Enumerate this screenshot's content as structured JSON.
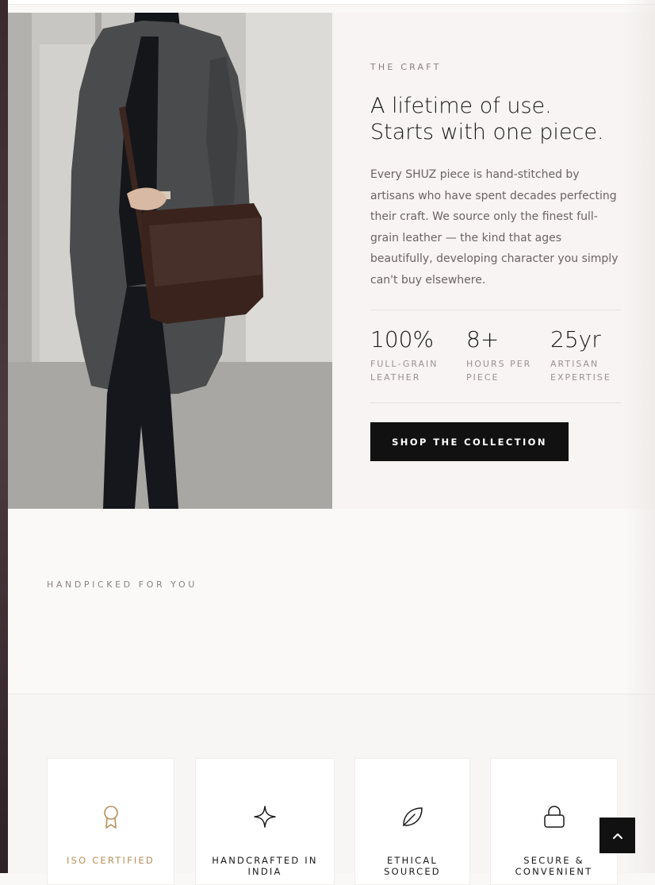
{
  "craft": {
    "eyebrow": "THE CRAFT",
    "title_lines": [
      "A lifetime of use.",
      "Starts with one piece."
    ],
    "body": "Every SHUZ piece is hand-stitched by artisans who have spent decades perfecting their craft. We source only the finest full-grain leather — the kind that ages beautifully, developing character you simply can't buy elsewhere.",
    "stats": [
      {
        "value": "100%",
        "label": "FULL-GRAIN LEATHER"
      },
      {
        "value": "8+",
        "label": "HOURS PER PIECE"
      },
      {
        "value": "25yr",
        "label": "ARTISAN EXPERTISE"
      }
    ],
    "cta_label": "SHOP THE COLLECTION",
    "image_icon": "man-with-leather-messenger-bag-photo"
  },
  "handpicked": {
    "eyebrow": "HANDPICKED FOR YOU"
  },
  "features": [
    {
      "icon": "award-ribbon-icon",
      "label": "ISO CERTIFIED",
      "color": "#b8905a"
    },
    {
      "icon": "sparkle-icon",
      "label": "HANDCRAFTED IN INDIA"
    },
    {
      "icon": "leaf-icon",
      "label": "ETHICAL SOURCED"
    },
    {
      "icon": "lock-icon",
      "label": "SECURE & CONVENIENT"
    }
  ],
  "back_to_top": {
    "icon": "chevron-up-icon"
  },
  "colors": {
    "accent_gold": "#b8905a",
    "button_dark": "#111111",
    "background": "#faf8f7"
  }
}
